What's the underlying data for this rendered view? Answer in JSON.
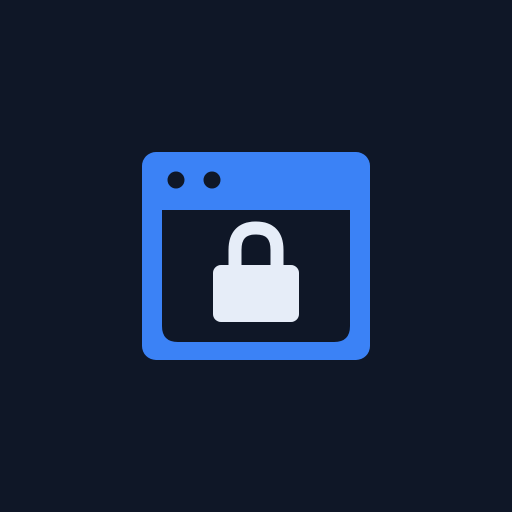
{
  "icon": {
    "name": "browser-lock-icon",
    "colors": {
      "background": "#0f1727",
      "window": "#3b82f6",
      "window_inner": "#0f1727",
      "lock": "#e6edf8"
    }
  }
}
